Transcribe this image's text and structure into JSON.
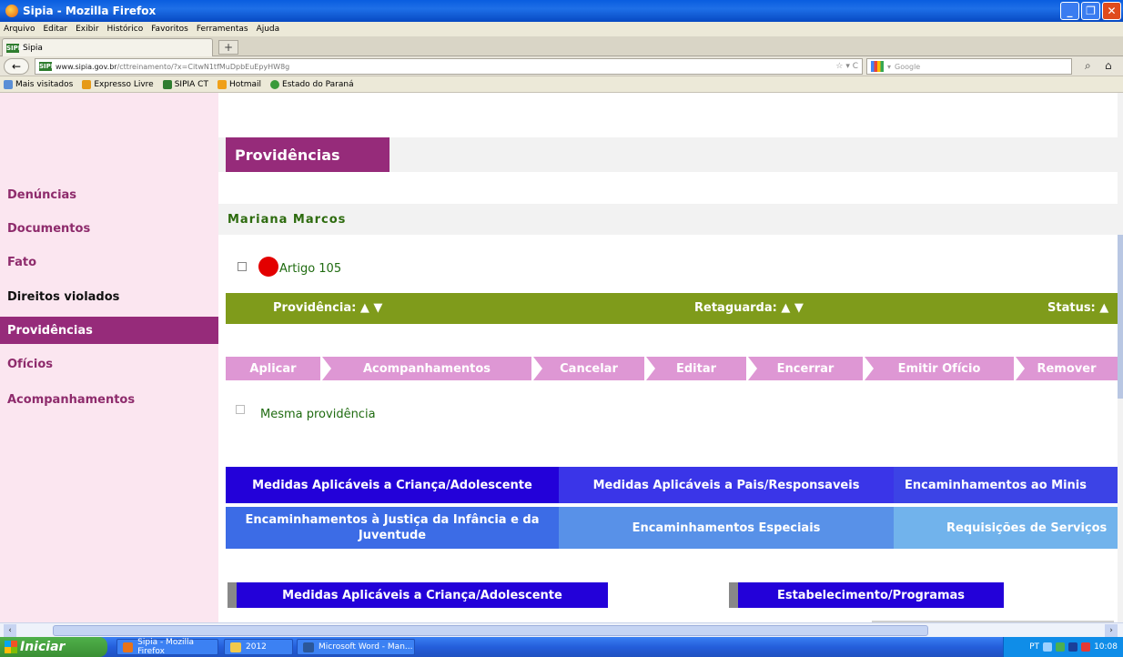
{
  "window": {
    "title": "Sipia - Mozilla Firefox"
  },
  "menu": [
    "Arquivo",
    "Editar",
    "Exibir",
    "Histórico",
    "Favoritos",
    "Ferramentas",
    "Ajuda"
  ],
  "tab": {
    "title": "Sipia",
    "favicon": "SIPIA"
  },
  "address": {
    "domain": "www.sipia.gov.br",
    "path": "/cttreinamento/?x=CitwN1tfMuDpbEuEpyHW8g"
  },
  "search": {
    "placeholder": "Google"
  },
  "bookmarks": [
    "Mais visitados",
    "Expresso Livre",
    "SIPIA CT",
    "Hotmail",
    "Estado do Paraná"
  ],
  "sidebar": {
    "items": [
      "Denúncias",
      "Documentos",
      "Fato",
      "Direitos violados",
      "Providências",
      "Ofícios",
      "Acompanhamentos"
    ],
    "active_index": 4
  },
  "page": {
    "title": "Providências",
    "person_name": "Mariana Marcos",
    "artigo_label": "Artigo 105",
    "columns": {
      "providencia": "Providência: ▲ ▼",
      "retaguarda": "Retaguarda: ▲ ▼",
      "status": "Status: ▲"
    },
    "actions": [
      "Aplicar",
      "Acompanhamentos",
      "Cancelar",
      "Editar",
      "Encerrar",
      "Emitir Ofício",
      "Remover"
    ],
    "same_measure_label": "Mesma providência",
    "nav_row1": [
      "Medidas Aplicáveis a Criança/Adolescente",
      "Medidas Aplicáveis a Pais/Responsaveis",
      "Encaminhamentos ao Minis"
    ],
    "nav_row2": [
      "Encaminhamentos à Justiça da Infância e da Juventude",
      "Encaminhamentos Especiais",
      "Requisições de Serviços"
    ],
    "subheads": [
      "Medidas Aplicáveis a Criança/Adolescente",
      "Estabelecimento/Programas"
    ]
  },
  "taskbar": {
    "start_label": "Iniciar",
    "buttons": [
      "Sipia - Mozilla Firefox",
      "2012",
      "Microsoft Word - Man..."
    ],
    "lang": "PT",
    "time": "10:08"
  },
  "colors": {
    "brand": "#962b7a",
    "green": "#7f9b1b",
    "action": "#de97d4",
    "nav_dark": "#2301d9"
  }
}
